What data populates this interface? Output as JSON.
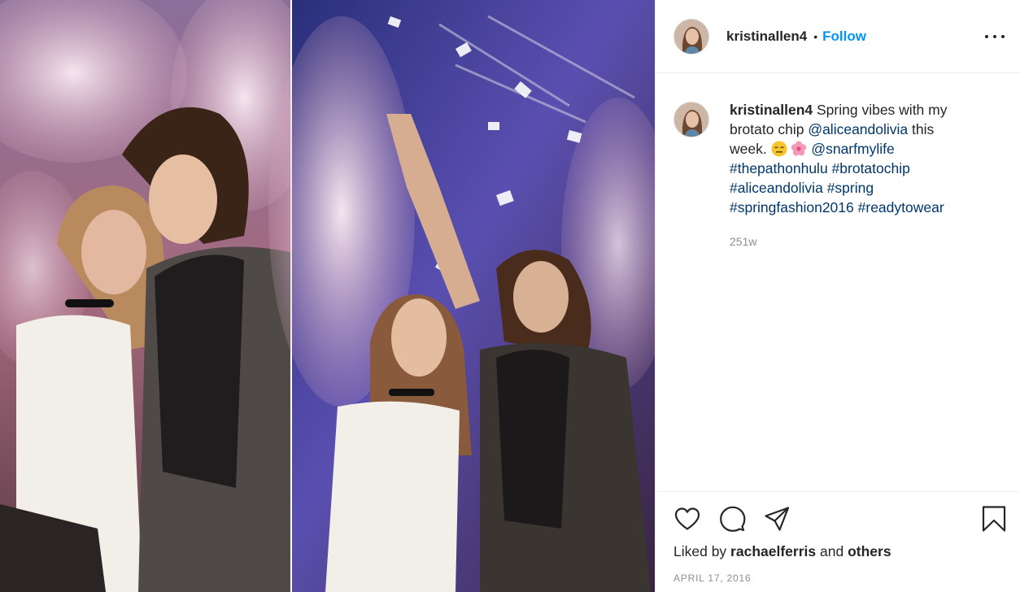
{
  "post": {
    "username": "kristinallen4",
    "separator": "•",
    "follow_label": "Follow",
    "more_icon": "more-options-icon",
    "image_alt": "Photo collage of two people under cherry blossom trees"
  },
  "caption": {
    "username": "kristinallen4",
    "text_1": " Spring vibes with my brotato chip ",
    "mention_1": "@aliceandolivia",
    "text_2": " this week. ",
    "emoji_1": "expressionless-face-emoji",
    "emoji_2": "cherry-blossom-emoji",
    "mention_2": "@snarfmylife",
    "hashtags": [
      "#thepathonhulu",
      "#brotatochip",
      "#aliceandolivia",
      "#spring",
      "#springfashion2016",
      "#readytowear"
    ],
    "time": "251w"
  },
  "actions": {
    "like_icon": "heart-icon",
    "comment_icon": "comment-icon",
    "share_icon": "share-icon",
    "save_icon": "bookmark-icon"
  },
  "likes": {
    "prefix": "Liked by ",
    "user": "rachaelferris",
    "middle": " and ",
    "others": "others"
  },
  "date": "APRIL 17, 2016",
  "colors": {
    "follow": "#0095f6",
    "link": "#00376b",
    "text": "#262626",
    "muted": "#8e8e8e",
    "border": "#efefef"
  }
}
